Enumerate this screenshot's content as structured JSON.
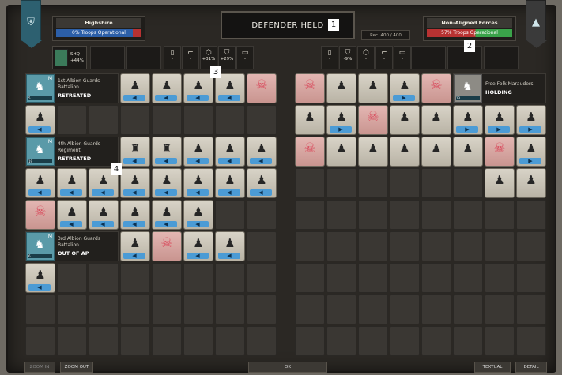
{
  "status": {
    "title": "DEFENDER HELD",
    "reinforcements": "Rec. 400 / 400"
  },
  "callouts": [
    "1",
    "2",
    "3",
    "4"
  ],
  "left_faction": {
    "name": "Highshire",
    "troops": "0% Troops Operational",
    "emblem_icon": "shield-icon"
  },
  "right_faction": {
    "name": "Non-Aligned Forces",
    "troops": "57% Troops Operational",
    "emblem_icon": "mountain-icon"
  },
  "hq": {
    "label": "SHQ",
    "bonus": "+44%"
  },
  "left_mods": [
    {
      "icon": "armor-icon",
      "value": "-"
    },
    {
      "icon": "rifle-icon",
      "value": "-"
    },
    {
      "icon": "hex-icon",
      "value": "+31%"
    },
    {
      "icon": "shield-icon",
      "value": "+29%"
    },
    {
      "icon": "ammo-icon",
      "value": "-"
    }
  ],
  "right_mods": [
    {
      "icon": "armor-icon",
      "value": "-"
    },
    {
      "icon": "shield-icon",
      "value": "-9%"
    },
    {
      "icon": "hex-icon",
      "value": "-"
    },
    {
      "icon": "rifle-icon",
      "value": "-"
    },
    {
      "icon": "ammo-icon",
      "value": "-"
    }
  ],
  "left_units": [
    {
      "name": "1st Albion Guards Battalion",
      "status": "RETREATED",
      "count": "5"
    },
    {
      "name": "4th Albion Guards Regiment",
      "status": "RETREATED",
      "count": "19"
    },
    {
      "name": "3rd Albion Guards Battalion",
      "status": "OUT OF AP",
      "count": "6"
    }
  ],
  "right_units": [
    {
      "name": "Free Folk Marauders",
      "status": "HOLDING",
      "count": "13"
    }
  ],
  "buttons": {
    "zoom_in": "ZOOM IN",
    "zoom_out": "ZOOM OUT",
    "ok": "OK",
    "textual": "TEXTUAL",
    "detail": "DETAIL"
  }
}
